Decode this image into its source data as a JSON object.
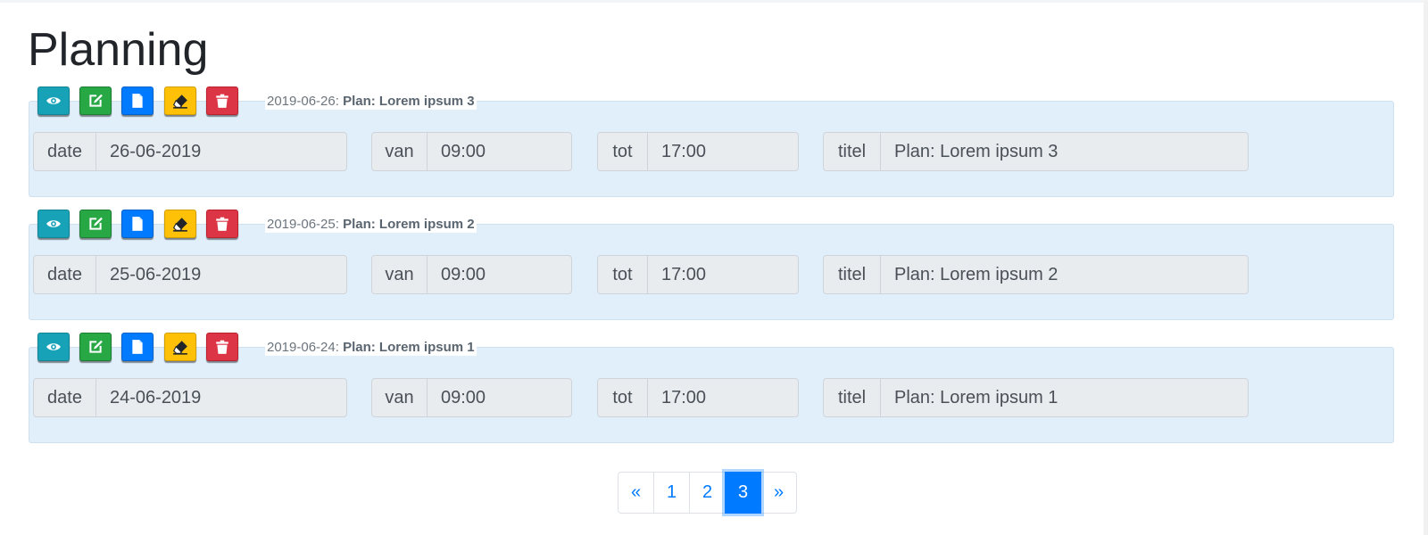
{
  "page": {
    "title": "Planning"
  },
  "labels": {
    "date": "date",
    "van": "van",
    "tot": "tot",
    "titel": "titel"
  },
  "records": [
    {
      "legend_date": "2019-06-26:",
      "legend_title": "Plan: Lorem ipsum 3",
      "date": "26-06-2019",
      "van": "09:00",
      "tot": "17:00",
      "titel": "Plan: Lorem ipsum 3"
    },
    {
      "legend_date": "2019-06-25:",
      "legend_title": "Plan: Lorem ipsum 2",
      "date": "25-06-2019",
      "van": "09:00",
      "tot": "17:00",
      "titel": "Plan: Lorem ipsum 2"
    },
    {
      "legend_date": "2019-06-24:",
      "legend_title": "Plan: Lorem ipsum 1",
      "date": "24-06-2019",
      "van": "09:00",
      "tot": "17:00",
      "titel": "Plan: Lorem ipsum 1"
    }
  ],
  "action_icons": [
    "eye-icon",
    "edit-icon",
    "document-icon",
    "eraser-icon",
    "trash-icon"
  ],
  "pagination": {
    "prev": "«",
    "pages": [
      "1",
      "2",
      "3"
    ],
    "active": "3",
    "next": "»"
  },
  "colors": {
    "view": "#17a2b8",
    "edit": "#28a745",
    "document": "#007bff",
    "erase": "#ffc107",
    "delete": "#dc3545",
    "panel": "#e1effb",
    "link": "#007bff"
  }
}
